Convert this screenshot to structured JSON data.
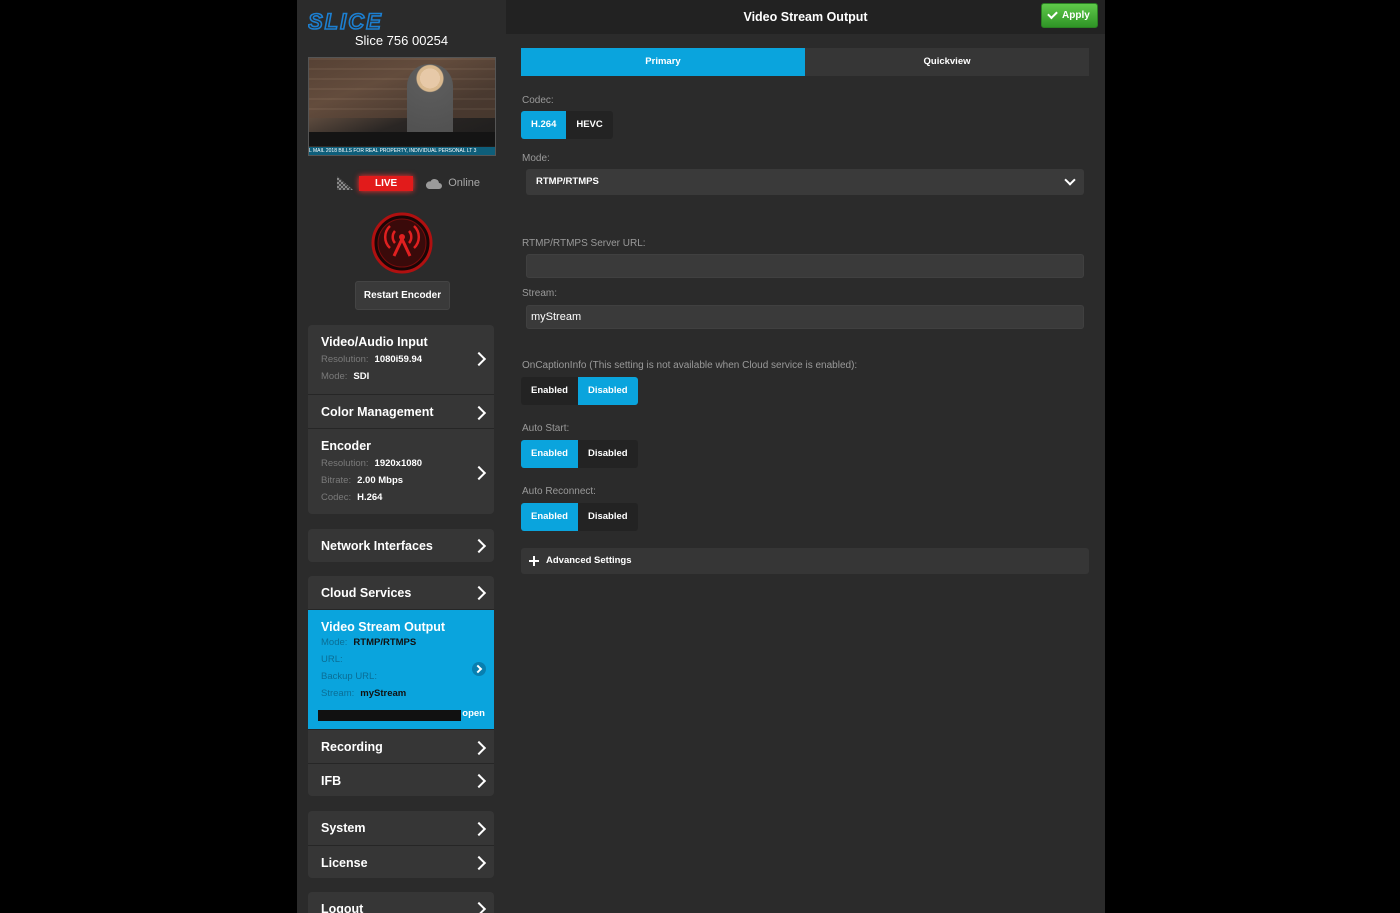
{
  "device": {
    "logo_text": "SLICE",
    "name": "Slice 756 00254"
  },
  "preview": {
    "ticker": "L MAIL 2018 BILLS FOR REAL PROPERTY, INDIVIDUAL PERSONAL LT 3"
  },
  "status": {
    "live": "LIVE",
    "cloud": "Online"
  },
  "restart_label": "Restart Encoder",
  "nav": {
    "video_audio": {
      "title": "Video/Audio Input",
      "res_k": "Resolution:",
      "res_v": "1080i59.94",
      "mode_k": "Mode:",
      "mode_v": "SDI"
    },
    "color": {
      "title": "Color Management"
    },
    "encoder": {
      "title": "Encoder",
      "res_k": "Resolution:",
      "res_v": "1920x1080",
      "bitrate_k": "Bitrate:",
      "bitrate_v": "2.00 Mbps",
      "codec_k": "Codec:",
      "codec_v": "H.264"
    },
    "network": {
      "title": "Network Interfaces"
    },
    "cloud": {
      "title": "Cloud Services"
    },
    "vso": {
      "title": "Video Stream Output",
      "mode_k": "Mode:",
      "mode_v": "RTMP/RTMPS",
      "url_k": "URL:",
      "backup_k": "Backup URL:",
      "stream_k": "Stream:",
      "stream_v": "myStream",
      "open": "open"
    },
    "recording": {
      "title": "Recording"
    },
    "ifb": {
      "title": "IFB"
    },
    "system": {
      "title": "System"
    },
    "license": {
      "title": "License"
    },
    "logout": {
      "title": "Logout"
    }
  },
  "main": {
    "title": "Video Stream Output",
    "apply": "Apply",
    "tabs": [
      "Primary",
      "Quickview"
    ],
    "codec": {
      "label": "Codec:",
      "options": [
        "H.264",
        "HEVC"
      ],
      "selected": "H.264"
    },
    "mode": {
      "label": "Mode:",
      "value": "RTMP/RTMPS"
    },
    "server_url": {
      "label": "RTMP/RTMPS Server URL:",
      "value": ""
    },
    "stream": {
      "label": "Stream:",
      "value": "myStream"
    },
    "oncaption": {
      "label": "OnCaptionInfo (This setting is not available when Cloud service is enabled):",
      "options": [
        "Enabled",
        "Disabled"
      ],
      "selected": "Disabled"
    },
    "auto_start": {
      "label": "Auto Start:",
      "options": [
        "Enabled",
        "Disabled"
      ],
      "selected": "Enabled"
    },
    "auto_reconnect": {
      "label": "Auto Reconnect:",
      "options": [
        "Enabled",
        "Disabled"
      ],
      "selected": "Enabled"
    },
    "advanced": "Advanced Settings"
  },
  "colors": {
    "accent": "#0aa4dd",
    "live": "#e21b1b",
    "apply": "#3fae30",
    "panel": "#2b2b2b"
  }
}
